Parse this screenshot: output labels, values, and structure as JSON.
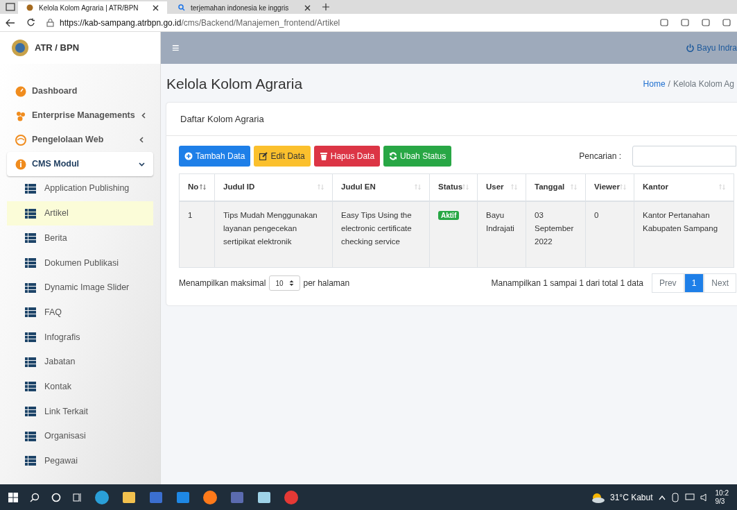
{
  "browser": {
    "tabs": [
      {
        "title": "Kelola Kolom Agraria | ATR/BPN",
        "selected": true
      },
      {
        "title": "terjemahan indonesia ke inggris",
        "selected": false
      }
    ],
    "url_host": "https://kab-sampang.atrbpn.go.id",
    "url_path": "/cms/Backend/Manajemen_frontend/Artikel"
  },
  "app": {
    "brand": "ATR / BPN",
    "menu_glyph": "≡",
    "user": "Bayu Indra"
  },
  "sidebar": {
    "items": [
      {
        "label": "Dashboard",
        "kind": "link"
      },
      {
        "label": "Enterprise Managements",
        "kind": "group",
        "expanded": false
      },
      {
        "label": "Pengelolaan Web",
        "kind": "group",
        "expanded": false
      },
      {
        "label": "CMS Modul",
        "kind": "group",
        "expanded": true,
        "children": [
          {
            "label": "Application Publishing",
            "selected": false
          },
          {
            "label": "Artikel",
            "selected": true
          },
          {
            "label": "Berita",
            "selected": false
          },
          {
            "label": "Dokumen Publikasi",
            "selected": false
          },
          {
            "label": "Dynamic Image Slider",
            "selected": false
          },
          {
            "label": "FAQ",
            "selected": false
          },
          {
            "label": "Infografis",
            "selected": false
          },
          {
            "label": "Jabatan",
            "selected": false
          },
          {
            "label": "Kontak",
            "selected": false
          },
          {
            "label": "Link Terkait",
            "selected": false
          },
          {
            "label": "Organisasi",
            "selected": false
          },
          {
            "label": "Pegawai",
            "selected": false
          }
        ]
      }
    ]
  },
  "page": {
    "title": "Kelola Kolom Agraria",
    "breadcrumb": [
      "Home",
      "/",
      "Kelola Kolom Ag"
    ]
  },
  "card": {
    "title": "Daftar Kolom Agraria",
    "buttons": [
      {
        "label": "Tambah Data",
        "kind": "add"
      },
      {
        "label": "Edit Data",
        "kind": "edit"
      },
      {
        "label": "Hapus Data",
        "kind": "delete"
      },
      {
        "label": "Ubah Status",
        "kind": "status"
      }
    ],
    "search_label": "Pencarian :",
    "table": {
      "columns": [
        "No",
        "Judul ID",
        "Judul EN",
        "Status",
        "User",
        "Tanggal",
        "Viewer",
        "Kantor"
      ],
      "rows": [
        {
          "no": "1",
          "judul_id": "Tips Mudah Menggunakan layanan pengecekan sertipikat elektronik",
          "judul_en": "Easy Tips Using the electronic certificate checking service",
          "status": "Aktif",
          "user": "Bayu Indrajati",
          "tanggal": "03 September 2022",
          "viewer": "0",
          "kantor": "Kantor Pertanahan Kabupaten Sampang"
        }
      ]
    },
    "page_size_prefix": "Menampilkan maksimal",
    "page_size": "10",
    "page_size_suffix": "per halaman",
    "summary": "Manampilkan 1 sampai 1 dari total 1 data",
    "pager": [
      {
        "label": "Prev",
        "selected": false
      },
      {
        "label": "1",
        "selected": true
      },
      {
        "label": "Next",
        "selected": false
      }
    ]
  },
  "taskbar": {
    "weather": "31°C Kabut",
    "time": "10:2",
    "date": "9/3"
  }
}
